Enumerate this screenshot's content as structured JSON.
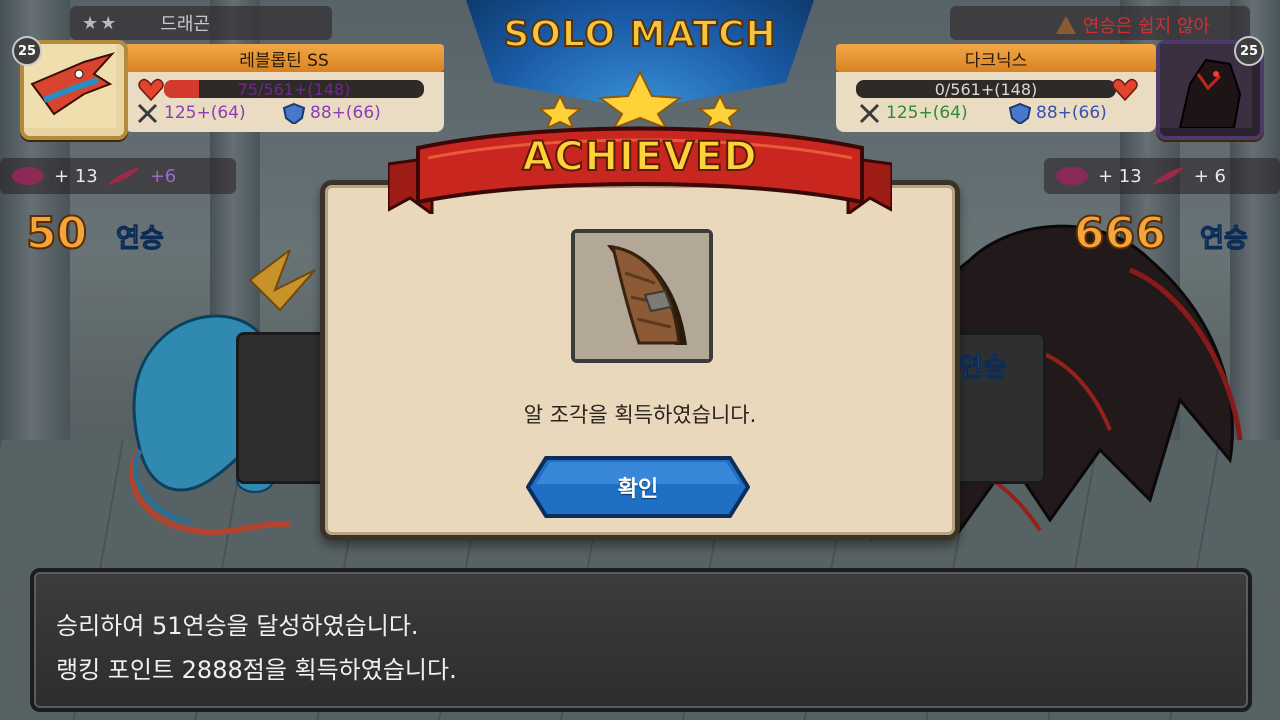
{
  "header": {
    "title": "SOLO MATCH"
  },
  "player_left": {
    "rank_stars": "★★",
    "rank_title": "드래곤",
    "level": "25",
    "name": "레블롭틴 SS",
    "hp_text": "75/561+(148)",
    "hp_fraction": 0.134,
    "attack": "125+(64)",
    "defense": "88+(66)",
    "resource_a": "+ 13",
    "resource_b": "+6",
    "streak_count": "50",
    "streak_label": "연승"
  },
  "player_right": {
    "warning_text": "연승은 쉽지 않아",
    "level": "25",
    "name": "다크닉스",
    "hp_text": "0/561+(148)",
    "hp_fraction": 0.0,
    "attack": "125+(64)",
    "defense": "88+(66)",
    "resource_a": "+ 13",
    "resource_b": "+ 6",
    "streak_count": "666",
    "streak_label": "연승",
    "behind_label": "연승"
  },
  "popup": {
    "banner": "ACHIEVED",
    "message": "알 조각을 획득하였습니다.",
    "confirm_label": "확인"
  },
  "result_message": {
    "line1": "승리하여 51연승을 달성하였습니다.",
    "line2": "랭킹 포인트 2888점을 획득하였습니다."
  },
  "colors": {
    "streak_number": "#f3a43a",
    "streak_label": "#3f8fe0",
    "banner_text": "#ffd23a",
    "ribbon": "#c8261f",
    "button": "#1f6fc4"
  }
}
